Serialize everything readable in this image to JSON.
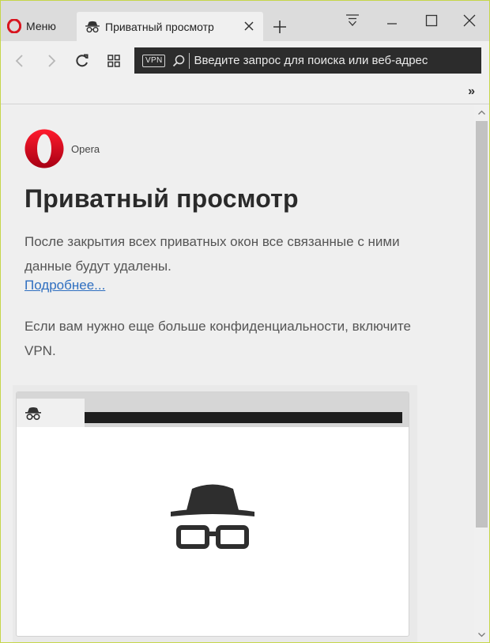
{
  "window": {
    "menu_label": "Меню",
    "tab_title": "Приватный просмотр",
    "controls": [
      "tab-menu",
      "minimize",
      "maximize",
      "close"
    ]
  },
  "toolbar": {
    "vpn_badge": "VPN",
    "address_placeholder": "Введите запрос для поиска или веб-адрес",
    "more_label": "»"
  },
  "page": {
    "brand_name": "Opera",
    "heading": "Приватный просмотр",
    "description": "После закрытия всех приватных окон все связанные с ними данные будут удалены.",
    "more_link": "Подробнее...",
    "vpn_hint": "Если вам нужно еще больше конфиденциальности, включите VPN."
  },
  "colors": {
    "opera_red": "#d8151f",
    "address_bar_bg": "#2c2c2c",
    "link": "#2f6fc0",
    "window_border": "#c6d64a"
  },
  "icons": {
    "menu": "opera-logo-icon",
    "tab": "incognito-icon",
    "tab_close": "close-icon",
    "new_tab": "plus-icon",
    "back": "back-arrow-icon",
    "forward": "forward-arrow-icon",
    "reload": "reload-icon",
    "speed_dial": "grid-icon",
    "search": "search-icon"
  }
}
